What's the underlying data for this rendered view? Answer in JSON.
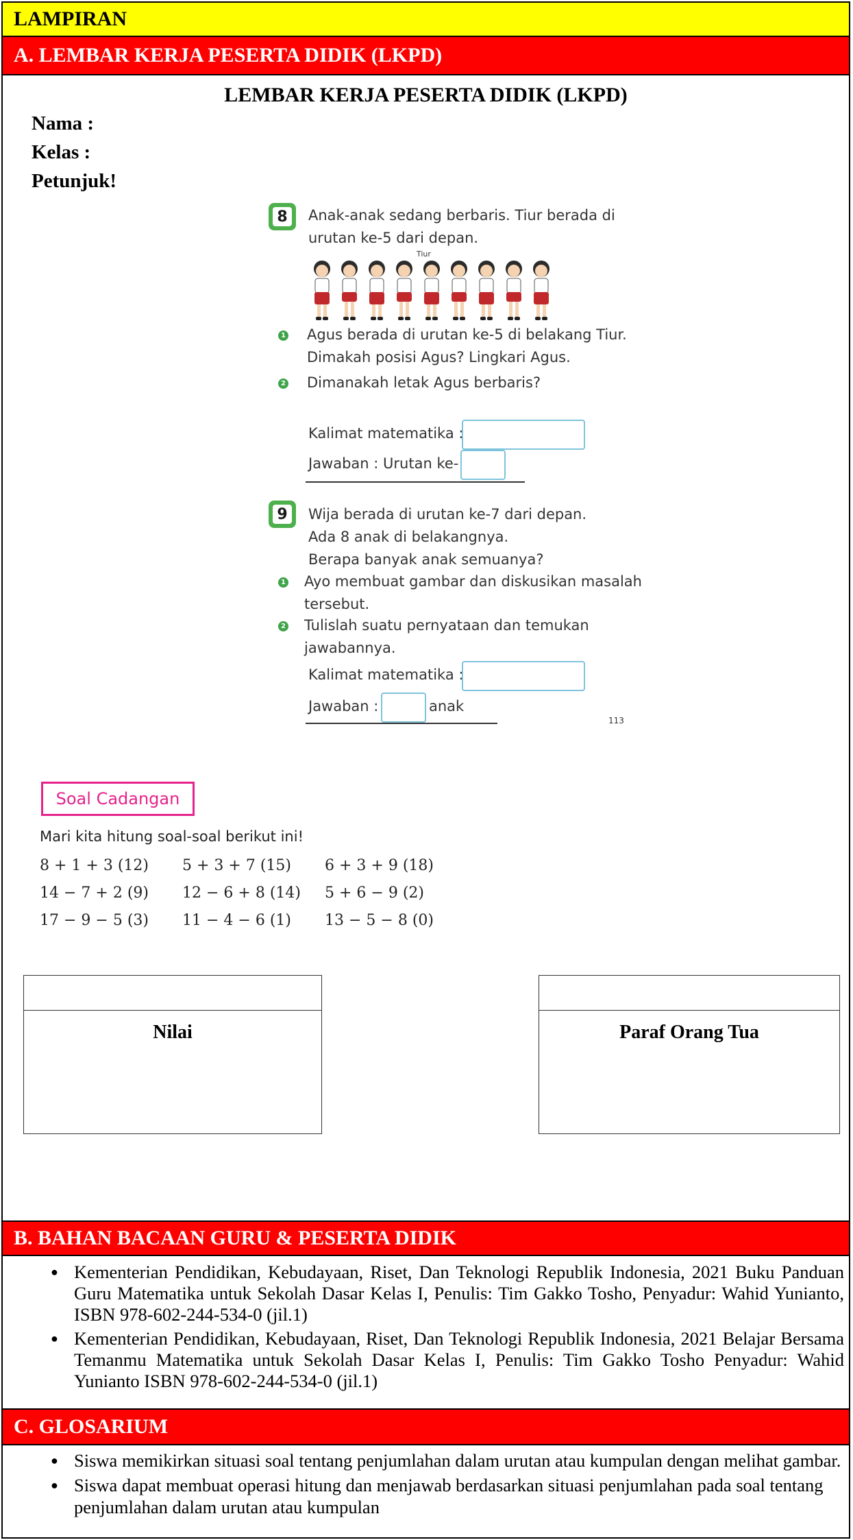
{
  "header": {
    "lampiran": "LAMPIRAN"
  },
  "section_a": {
    "heading": "A. LEMBAR KERJA PESERTA DIDIK (LKPD)",
    "title": "LEMBAR KERJA PESERTA DIDIK (LKPD)",
    "nama_label": "Nama :",
    "kelas_label": "Kelas :",
    "petunjuk_label": "Petunjuk!"
  },
  "problem8": {
    "number": "8",
    "text_line1": "Anak-anak sedang berbaris. Tiur berada di",
    "text_line2": "urutan ke-5 dari depan.",
    "tiur_label": "Tiur",
    "step1_num": "1",
    "step1_line1": "Agus berada di urutan ke-5 di belakang Tiur.",
    "step1_line2": "Dimakah posisi Agus? Lingkari Agus.",
    "step2_num": "2",
    "step2_text": "Dimanakah letak Agus berbaris?",
    "kalimat_label": "Kalimat matematika :",
    "jawaban_label": "Jawaban : Urutan ke-"
  },
  "problem9": {
    "number": "9",
    "line1": "Wija berada di urutan ke-7 dari depan.",
    "line2": "Ada 8 anak di belakangnya.",
    "line3": "Berapa banyak anak semuanya?",
    "step1_num": "1",
    "step1_line1": "Ayo membuat gambar dan diskusikan masalah",
    "step1_line2": "tersebut.",
    "step2_num": "2",
    "step2_line1": "Tulislah suatu pernyataan dan temukan",
    "step2_line2": "jawabannya.",
    "kalimat_label": "Kalimat matematika :",
    "jawaban_label": "Jawaban :",
    "anak_label": "anak",
    "page_number": "113"
  },
  "soal_cadangan": {
    "title": "Soal Cadangan",
    "instruction": "Mari kita hitung soal-soal berikut ini!",
    "items": [
      "8 + 1 + 3   (12)",
      "5 + 3 + 7   (15)",
      "6 + 3 + 9   (18)",
      "14 − 7 + 2  (9)",
      "12 − 6 + 8  (14)",
      "5 + 6 − 9   (2)",
      "17 − 9 − 5  (3)",
      "11 − 4 − 6  (1)",
      "13 − 5 − 8  (0)"
    ]
  },
  "signatures": {
    "nilai": "Nilai",
    "paraf": "Paraf Orang Tua"
  },
  "section_b": {
    "heading": "B. BAHAN BACAAN GURU & PESERTA DIDIK",
    "items": [
      "Kementerian Pendidikan, Kebudayaan, Riset, Dan Teknologi Republik Indonesia, 2021 Buku Panduan Guru Matematika untuk Sekolah Dasar Kelas I, Penulis: Tim Gakko Tosho, Penyadur: Wahid Yunianto, ISBN 978-602-244-534-0 (jil.1)",
      "Kementerian Pendidikan, Kebudayaan, Riset, Dan Teknologi Republik Indonesia, 2021 Belajar Bersama Temanmu Matematika untuk Sekolah Dasar Kelas I, Penulis: Tim Gakko Tosho Penyadur: Wahid Yunianto ISBN 978-602-244-534-0 (jil.1)"
    ]
  },
  "section_c": {
    "heading": "C. GLOSARIUM",
    "items": [
      "Siswa memikirkan situasi soal tentang penjumlahan dalam urutan atau kumpulan dengan melihat gambar.",
      "Siswa dapat membuat operasi hitung dan menjawab berdasarkan situasi penjumlahan pada soal tentang penjumlahan dalam urutan atau kumpulan"
    ]
  },
  "colors": {
    "yellow_bar": "#ffff00",
    "red_bar": "#ff0000",
    "badge_green": "#4db04d",
    "soal_pink": "#e6228c",
    "answer_box": "#7ec3dc"
  }
}
